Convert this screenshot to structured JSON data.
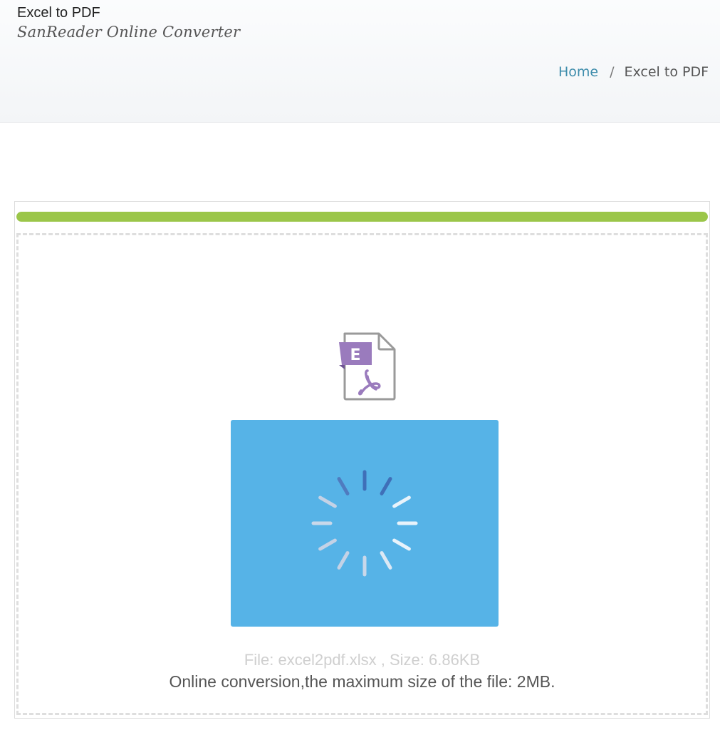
{
  "header": {
    "title": "Excel to PDF",
    "subtitle": "SanReader Online Converter"
  },
  "breadcrumb": {
    "home": "Home",
    "separator": "/",
    "current": "Excel to PDF"
  },
  "upload": {
    "progress_percent": 100,
    "progress_color": "#9bc649",
    "file_icon": "excel-to-pdf-file-icon",
    "file_icon_letter": "E",
    "convert_box_color": "#56b3e7",
    "loading_icon": "loading-spinner-icon",
    "file_info": "File: excel2pdf.xlsx , Size: 6.86KB",
    "limit_text": "Online conversion,the maximum size of the file: 2MB."
  }
}
